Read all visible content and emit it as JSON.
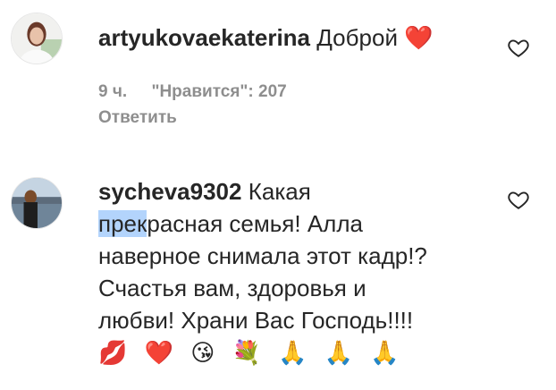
{
  "comments": [
    {
      "username": "artyukovaekaterina",
      "text": "Доброй ❤️",
      "time": "9 ч.",
      "likes": "\"Нравится\": 207",
      "reply_label": "Ответить"
    },
    {
      "username": "sycheva9302",
      "text_pre": " Какая",
      "line2_highlight": "прек",
      "line2_rest": "расная семья! Алла",
      "line3": "наверное снимала этот кадр!?",
      "line4": "Счастья вам, здоровья и",
      "line5": "любви! Храни Вас Господь!!!!",
      "emojis": "💋 ❤️ 😘 💐 🙏 🙏 🙏"
    }
  ],
  "icons": {
    "like": "heart-outline-icon"
  }
}
